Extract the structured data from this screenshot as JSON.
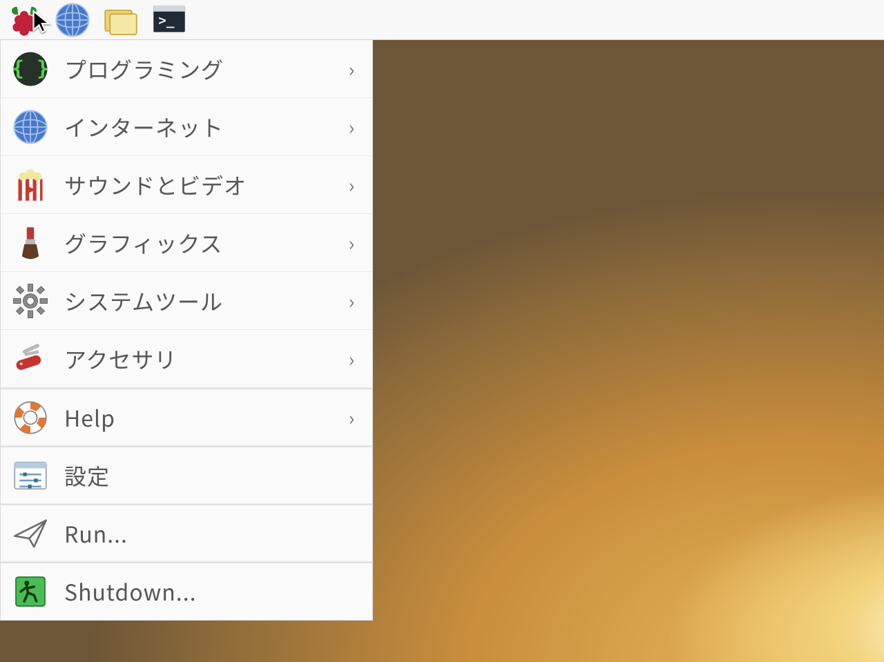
{
  "taskbar": {
    "items": [
      {
        "name": "menu-button",
        "icon": "raspberry-icon"
      },
      {
        "name": "web-browser-button",
        "icon": "globe-icon"
      },
      {
        "name": "file-manager-button",
        "icon": "folder-icon"
      },
      {
        "name": "terminal-button",
        "icon": "terminal-icon"
      }
    ]
  },
  "menu": {
    "items": [
      {
        "name": "menu-item-programming",
        "label": "プログラミング",
        "icon": "code-braces-icon",
        "submenu": true
      },
      {
        "name": "menu-item-internet",
        "label": "インターネット",
        "icon": "globe-icon",
        "submenu": true
      },
      {
        "name": "menu-item-sound-video",
        "label": "サウンドとビデオ",
        "icon": "popcorn-icon",
        "submenu": true
      },
      {
        "name": "menu-item-graphics",
        "label": "グラフィックス",
        "icon": "paintbrush-icon",
        "submenu": true
      },
      {
        "name": "menu-item-system-tools",
        "label": "システムツール",
        "icon": "gear-icon",
        "submenu": true
      },
      {
        "name": "menu-item-accessories",
        "label": "アクセサリ",
        "icon": "swissknife-icon",
        "submenu": true
      },
      {
        "name": "menu-item-help",
        "label": "Help",
        "icon": "lifebuoy-icon",
        "submenu": true,
        "sep": true
      },
      {
        "name": "menu-item-preferences",
        "label": "設定",
        "icon": "sliders-icon",
        "submenu": false,
        "sep": true
      },
      {
        "name": "menu-item-run",
        "label": "Run...",
        "icon": "paperplane-icon",
        "submenu": false,
        "sep": true
      },
      {
        "name": "menu-item-shutdown",
        "label": "Shutdown...",
        "icon": "exit-icon",
        "submenu": false,
        "sep": true
      }
    ]
  },
  "chevron_glyph": "›"
}
